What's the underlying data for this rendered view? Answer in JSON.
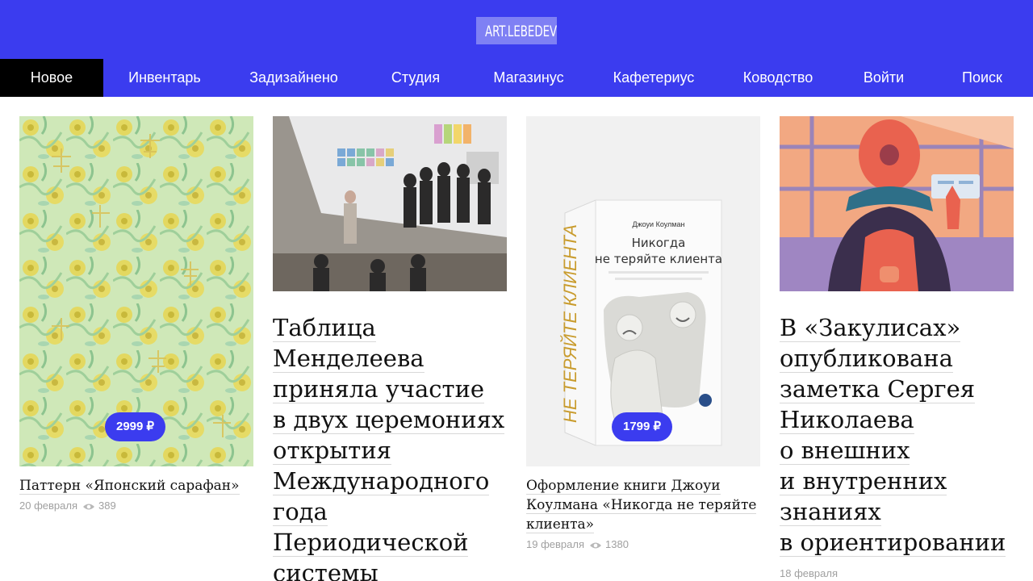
{
  "header": {
    "logo_text": "ART.LEBEDEV",
    "brand_color": "#3b3cef"
  },
  "nav": {
    "items": [
      "Новое",
      "Инвентарь",
      "Задизайнено",
      "Студия",
      "Магазинус",
      "Кафетериус",
      "Ководство",
      "Войти",
      "Поиск"
    ],
    "active_index": 0
  },
  "cards": [
    {
      "price": "2999 ₽",
      "title": "Паттерн «Японский сарафан»",
      "date": "20 февраля",
      "views": "389"
    },
    {
      "headline_lines": [
        "Таблица",
        "Менделеева",
        "приняла участие",
        "в двух церемониях",
        "открытия",
        "Международного",
        "года",
        "Периодической",
        "системы"
      ]
    },
    {
      "book_author": "Джоуи Коулман",
      "book_title_1": "Никогда",
      "book_title_2": "не теряйте клиента",
      "book_spine": "НЕ ТЕРЯЙТЕ КЛИЕНТА",
      "price": "1799 ₽",
      "title_lines": [
        "Оформление книги Джоуи",
        "Коулмана «Никогда не теряйте",
        "клиента»"
      ],
      "date": "19 февраля",
      "views": "1380"
    },
    {
      "headline_lines": [
        "В «Закулисах»",
        "опубликована",
        "заметка Сергея",
        "Николаева",
        "о внешних",
        "и внутренних",
        "знаниях",
        "в ориентировании"
      ],
      "date": "18 февраля"
    }
  ]
}
